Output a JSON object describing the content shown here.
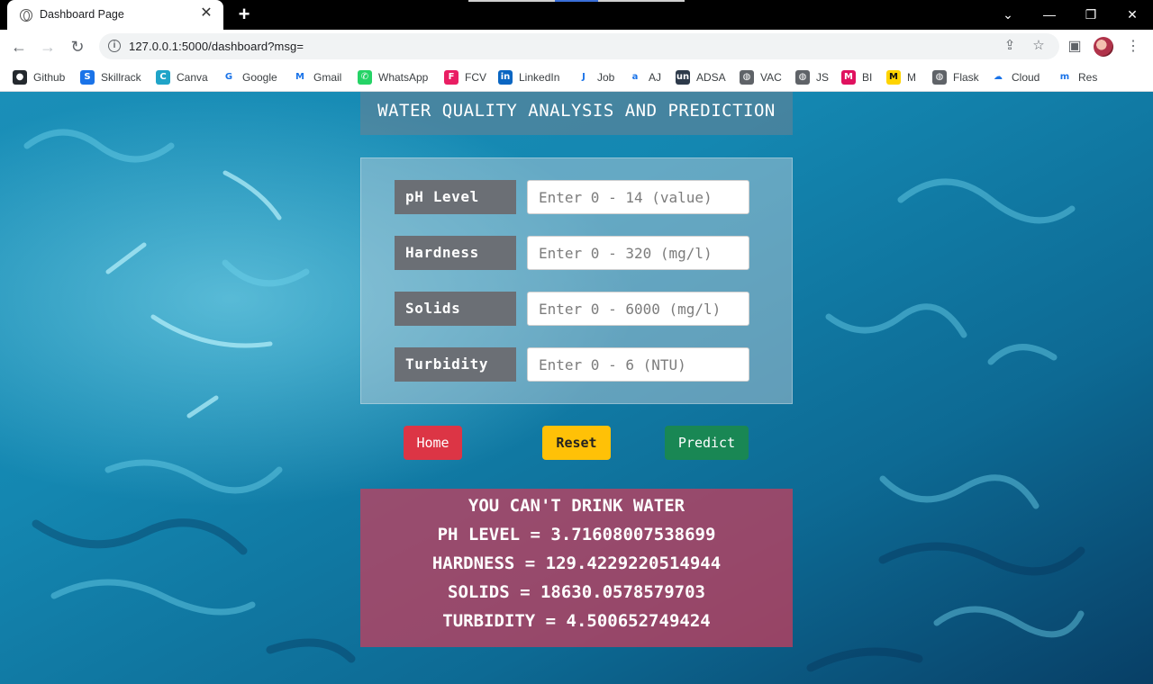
{
  "browser": {
    "tab_title": "Dashboard Page",
    "tab_close": "✕",
    "new_tab": "+",
    "url": "127.0.0.1:5000/dashboard?msg=",
    "window_controls": {
      "dropdown": "⌄",
      "minimize": "—",
      "restore": "❐",
      "close": "✕"
    }
  },
  "bookmarks": [
    {
      "label": "Github",
      "icon": "github-icon",
      "color": "#24292e",
      "glyph": "●"
    },
    {
      "label": "Skillrack",
      "icon": "skillrack-icon",
      "color": "#1a73e8",
      "glyph": "S"
    },
    {
      "label": "Canva",
      "icon": "canva-icon",
      "color": "#20a4c8",
      "glyph": "C"
    },
    {
      "label": "Google",
      "icon": "google-icon",
      "color": "#ffffff",
      "glyph": "G"
    },
    {
      "label": "Gmail",
      "icon": "gmail-icon",
      "color": "#ffffff",
      "glyph": "M"
    },
    {
      "label": "WhatsApp",
      "icon": "whatsapp-icon",
      "color": "#25d366",
      "glyph": "✆"
    },
    {
      "label": "FCV",
      "icon": "fcv-icon",
      "color": "#e91e63",
      "glyph": "F"
    },
    {
      "label": "LinkedIn",
      "icon": "linkedin-icon",
      "color": "#0a66c2",
      "glyph": "in"
    },
    {
      "label": "Job",
      "icon": "job-icon",
      "color": "#ffffff",
      "glyph": "J"
    },
    {
      "label": "AJ",
      "icon": "amazon-icon",
      "color": "#ffffff",
      "glyph": "a"
    },
    {
      "label": "ADSA",
      "icon": "adsa-icon",
      "color": "#2d3a4a",
      "glyph": "un"
    },
    {
      "label": "VAC",
      "icon": "vac-icon",
      "color": "#5f6368",
      "glyph": "◍"
    },
    {
      "label": "JS",
      "icon": "js-icon",
      "color": "#5f6368",
      "glyph": "◍"
    },
    {
      "label": "BI",
      "icon": "bi-icon",
      "color": "#e0115f",
      "glyph": "M"
    },
    {
      "label": "M",
      "icon": "m-icon",
      "color": "#ffd400",
      "glyph": "M"
    },
    {
      "label": "Flask",
      "icon": "flask-icon",
      "color": "#5f6368",
      "glyph": "◍"
    },
    {
      "label": "Cloud",
      "icon": "cloud-icon",
      "color": "#ffffff",
      "glyph": "☁"
    },
    {
      "label": "Res",
      "icon": "res-icon",
      "color": "#ffffff",
      "glyph": "m"
    }
  ],
  "page": {
    "heading": "WATER QUALITY ANALYSIS AND PREDICTION",
    "fields": [
      {
        "label": "pH Level",
        "placeholder": "Enter 0 - 14 (value)"
      },
      {
        "label": "Hardness",
        "placeholder": "Enter 0 - 320 (mg/l)"
      },
      {
        "label": "Solids",
        "placeholder": "Enter 0 - 6000 (mg/l)"
      },
      {
        "label": "Turbidity",
        "placeholder": "Enter 0 - 6 (NTU)"
      }
    ],
    "buttons": {
      "home": "Home",
      "reset": "Reset",
      "predict": "Predict"
    },
    "result": {
      "verdict": "YOU CAN'T DRINK WATER",
      "ph": "PH LEVEL = 3.71608007538699",
      "hardness": "HARDNESS = 129.4229220514944",
      "solids": "SOLIDS = 18630.0578579703",
      "turbidity": "TURBIDITY = 4.500652749424"
    }
  }
}
